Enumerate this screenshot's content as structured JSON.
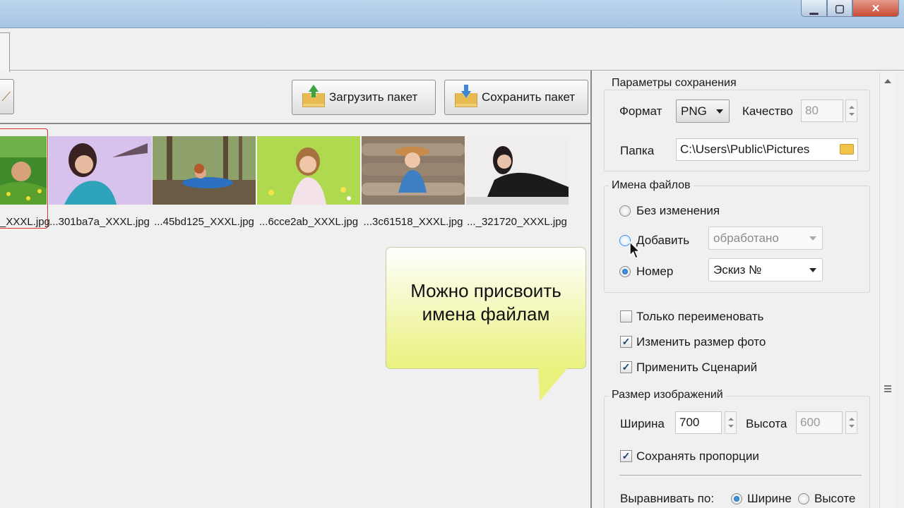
{
  "toolbar": {
    "load_label": "Загрузить пакет",
    "save_label": "Сохранить пакет"
  },
  "thumbnails": [
    {
      "label": "_XXXL.jpg"
    },
    {
      "label": "...301ba7a_XXXL.jpg"
    },
    {
      "label": "...45bd125_XXXL.jpg"
    },
    {
      "label": "...6cce2ab_XXXL.jpg"
    },
    {
      "label": "...3c61518_XXXL.jpg"
    },
    {
      "label": "..._321720_XXXL.jpg"
    }
  ],
  "tooltip": {
    "text": "Можно присвоить имена файлам"
  },
  "save_params": {
    "title": "Параметры сохранения",
    "format_label": "Формат",
    "format_value": "PNG",
    "quality_label": "Качество",
    "quality_value": "80",
    "folder_label": "Папка",
    "folder_value": "C:\\Users\\Public\\Pictures"
  },
  "file_names": {
    "title": "Имена файлов",
    "unchanged_label": "Без изменения",
    "add_label": "Добавить",
    "add_value": "обработано",
    "number_label": "Номер",
    "number_value": "Эскиз №"
  },
  "options": {
    "rename_only": "Только переименовать",
    "resize": "Изменить размер фото",
    "apply_scenario": "Применить Сценарий"
  },
  "image_size": {
    "title": "Размер изображений",
    "width_label": "Ширина",
    "width_value": "700",
    "height_label": "Высота",
    "height_value": "600",
    "keep_ratio": "Сохранять пропорции",
    "align_label": "Выравнивать по:",
    "align_width": "Ширине",
    "align_height": "Высоте"
  },
  "colors": {
    "accent": "#1b5fae",
    "tooltip_bg": "#eaf27e",
    "selection": "#e03030"
  }
}
